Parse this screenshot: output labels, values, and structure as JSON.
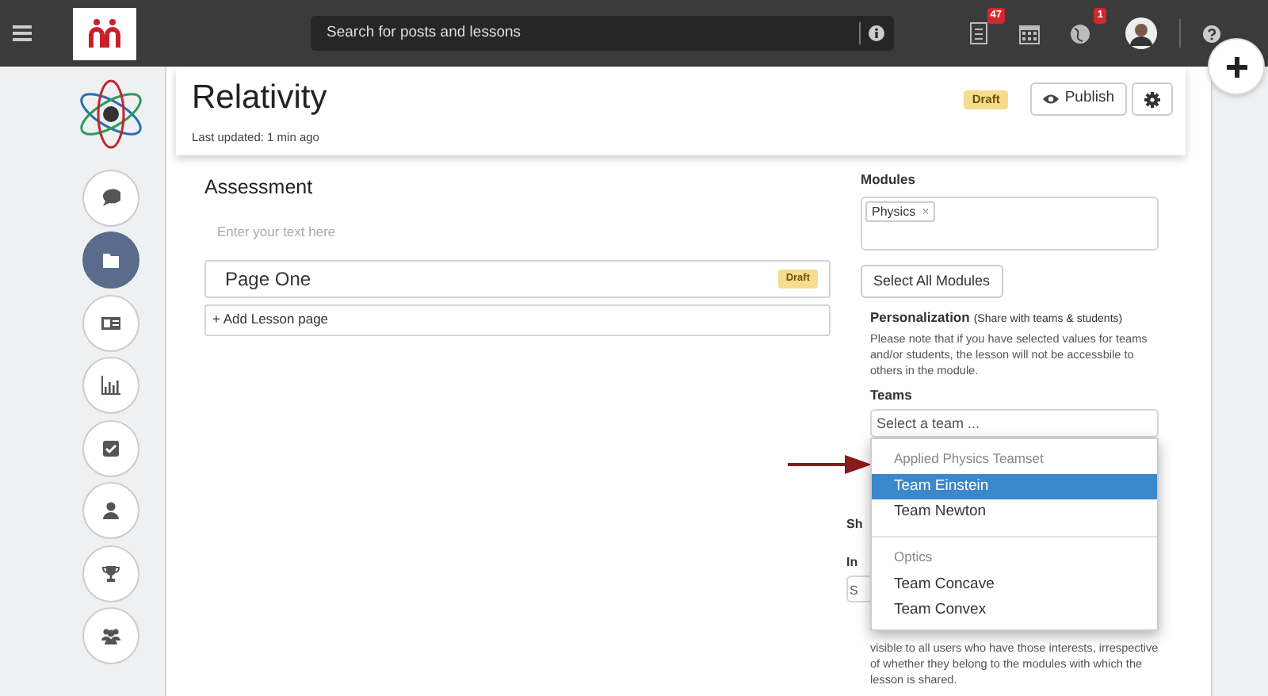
{
  "navbar": {
    "search_placeholder": "Search for posts and lessons",
    "notifications_badge": "47",
    "globe_badge": "1"
  },
  "sidebar": {
    "items": [
      {
        "kind": "chat",
        "selected": false
      },
      {
        "kind": "folder",
        "selected": true
      },
      {
        "kind": "media",
        "selected": false
      },
      {
        "kind": "chart",
        "selected": false
      },
      {
        "kind": "check",
        "selected": false
      },
      {
        "kind": "user",
        "selected": false
      },
      {
        "kind": "trophy",
        "selected": false
      },
      {
        "kind": "group",
        "selected": false
      }
    ]
  },
  "lesson": {
    "title": "Relativity",
    "status": "Draft",
    "last_updated": "Last updated: 1 min ago",
    "publish_label": "Publish"
  },
  "assessment": {
    "heading": "Assessment",
    "placeholder": "Enter your text here",
    "pages": [
      {
        "title": "Page One",
        "status": "Draft"
      }
    ],
    "add_page": "+ Add Lesson page"
  },
  "modules": {
    "label": "Modules",
    "tags": [
      {
        "label": "Physics",
        "remove": "×"
      }
    ],
    "select_all": "Select All Modules"
  },
  "personalization": {
    "title": "Personalization",
    "hint": "(Share with teams & students)",
    "note": "Please note that if you have selected values for teams and/or students, the lesson will not be accessbile to others in the module."
  },
  "teams": {
    "label": "Teams",
    "placeholder": "Select a team ...",
    "groups": [
      {
        "label": "Applied Physics Teamset",
        "options": [
          {
            "label": "Team Einstein",
            "selected": true
          },
          {
            "label": "Team Newton",
            "selected": false
          }
        ]
      },
      {
        "label": "Optics",
        "options": [
          {
            "label": "Team Concave",
            "selected": false
          },
          {
            "label": "Team Convex",
            "selected": false
          }
        ]
      }
    ]
  },
  "covered": {
    "label_1": "Sh",
    "label_2": "In",
    "field_value": "S",
    "note": "visible to all users who have those interests, irrespective of whether they belong to the modules with which the lesson is shared."
  }
}
